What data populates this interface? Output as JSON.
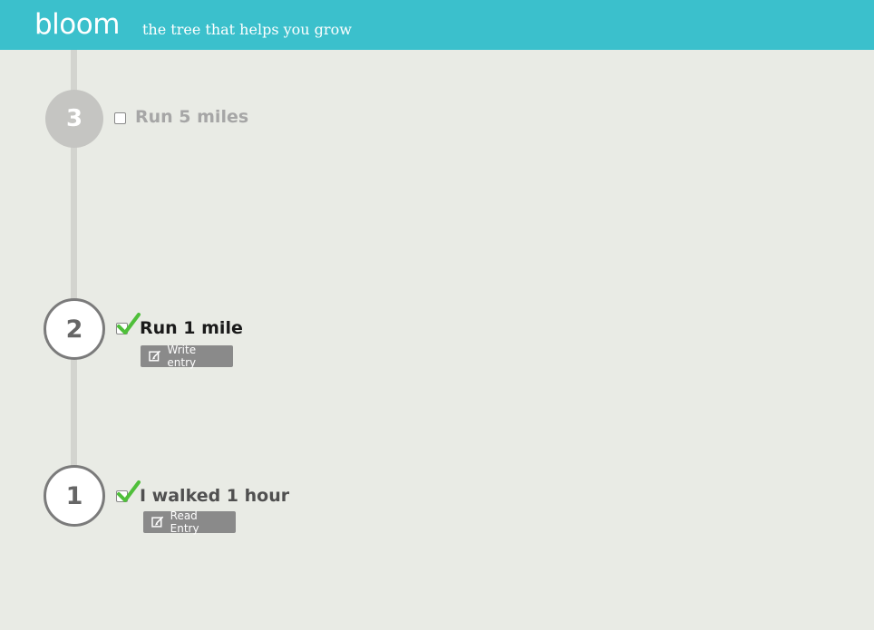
{
  "header": {
    "logo": "bloom",
    "tagline": "the tree that helps you grow",
    "color": "#3bc0cc"
  },
  "goals": [
    {
      "number": "3",
      "label": "Run 5 miles",
      "checked": false
    },
    {
      "number": "2",
      "label": "Run 1 mile",
      "checked": true,
      "button_label": "Write entry",
      "button_icon": "edit-icon"
    },
    {
      "number": "1",
      "label": "I walked 1 hour",
      "checked": true,
      "button_label": "Read Entry",
      "button_icon": "edit-icon"
    }
  ],
  "colors": {
    "background": "#e9ebe5",
    "check_green": "#4fbf3a",
    "button_gray": "#8a8a8a"
  }
}
